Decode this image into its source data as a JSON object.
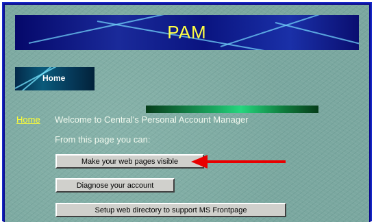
{
  "header": {
    "title": "PAM"
  },
  "nav": {
    "home_tab_label": "Home",
    "home_link_label": "Home"
  },
  "main": {
    "welcome_text": "Welcome to Central's Personal Account Manager",
    "subtitle": "From this page you can:",
    "buttons": [
      {
        "label": "Make your web pages visible"
      },
      {
        "label": "Diagnose your account"
      },
      {
        "label": "Setup web directory to support MS Frontpage"
      }
    ]
  },
  "colors": {
    "title_text": "#ffff44",
    "link": "#ffff33",
    "panel_background": "#7ba8a0",
    "arrow": "#e80000"
  }
}
